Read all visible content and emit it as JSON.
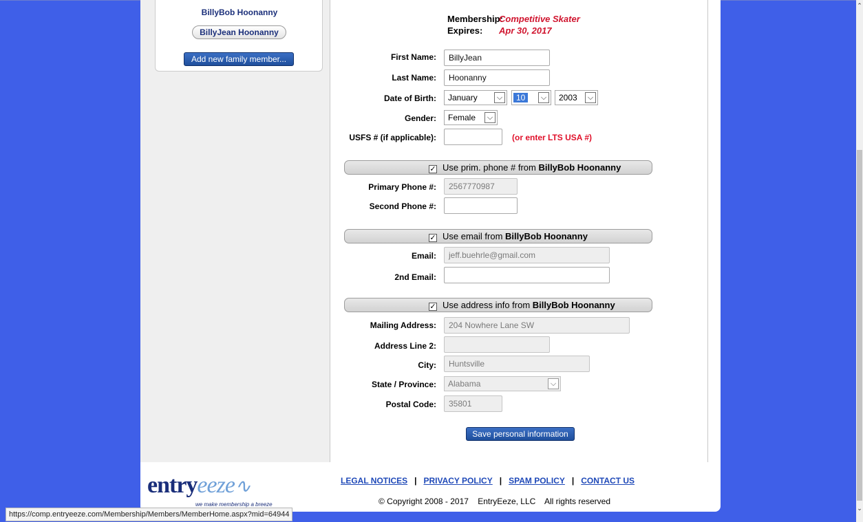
{
  "family": {
    "members": [
      "BillyBob Hoonanny"
    ],
    "selected": "BillyJean Hoonanny",
    "add_button": "Add new family member..."
  },
  "membership": {
    "label": "Membership:",
    "value": "Competitive Skater",
    "expires_label": "Expires:",
    "expires_value": "Apr 30, 2017"
  },
  "form": {
    "first_name": {
      "label": "First Name:",
      "value": "BillyJean"
    },
    "last_name": {
      "label": "Last Name:",
      "value": "Hoonanny"
    },
    "dob": {
      "label": "Date of Birth:",
      "month": "January",
      "day": "10",
      "year": "2003"
    },
    "gender": {
      "label": "Gender:",
      "value": "Female"
    },
    "usfs": {
      "label": "USFS # (if applicable):",
      "value": "",
      "note": "(or enter LTS USA #)"
    },
    "phone_bar": {
      "text": "Use prim. phone # from ",
      "name": "BillyBob Hoonanny"
    },
    "primary_phone": {
      "label": "Primary Phone #:",
      "value": "2567770987"
    },
    "second_phone": {
      "label": "Second Phone #:",
      "value": ""
    },
    "email_bar": {
      "text": "Use email from ",
      "name": "BillyBob Hoonanny"
    },
    "email": {
      "label": "Email:",
      "value": "jeff.buehrle@gmail.com"
    },
    "email2": {
      "label": "2nd Email:",
      "value": ""
    },
    "address_bar": {
      "text": "Use address info from ",
      "name": "BillyBob Hoonanny"
    },
    "mailing": {
      "label": "Mailing Address:",
      "value": "204 Nowhere Lane SW"
    },
    "address2": {
      "label": "Address Line 2:",
      "value": ""
    },
    "city": {
      "label": "City:",
      "value": "Huntsville"
    },
    "state": {
      "label": "State / Province:",
      "value": "Alabama"
    },
    "postal": {
      "label": "Postal Code:",
      "value": "35801"
    },
    "save_button": "Save personal information"
  },
  "footer": {
    "logo_main": "entry",
    "logo_accent": "eeze",
    "tagline": "we make membership a breeze",
    "links": [
      "LEGAL NOTICES",
      "PRIVACY POLICY",
      "SPAM POLICY",
      "CONTACT US"
    ],
    "copyright": "© Copyright 2008 - 2017    EntryEeze, LLC    All rights reserved"
  },
  "status_url": "https://comp.entryeeze.com/Membership/Members/MemberHome.aspx?mid=64944",
  "colors": {
    "background": "#3f5fe8",
    "accent_red": "#d0142e",
    "button_blue": "#1f4f9c",
    "link_blue": "#1f49b8"
  }
}
